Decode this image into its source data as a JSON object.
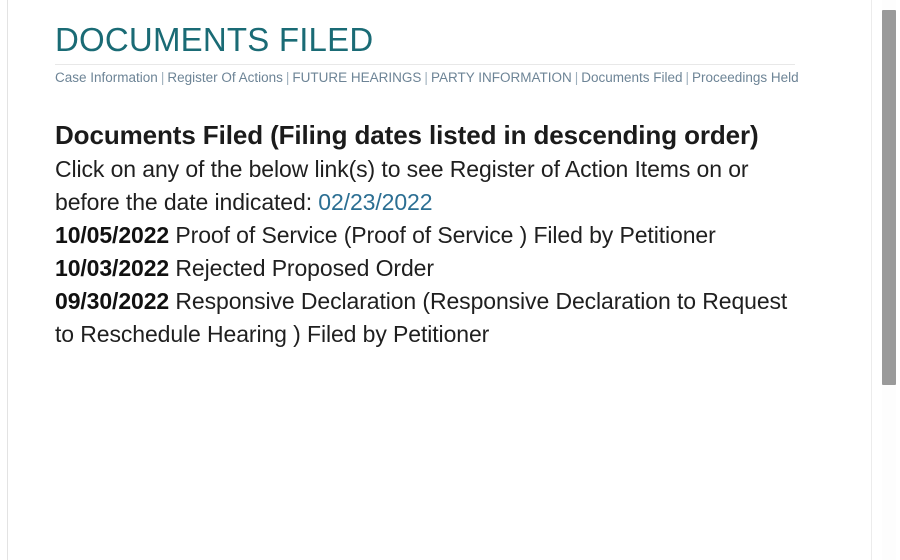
{
  "page": {
    "title": "DOCUMENTS FILED",
    "accent_color": "#1a6b75",
    "link_color": "#2c6f93",
    "nav_color": "#6d8496",
    "background": "#ffffff"
  },
  "nav": {
    "separator": "|",
    "items": [
      {
        "label": "Case Information"
      },
      {
        "label": "Register Of Actions"
      },
      {
        "label": "FUTURE HEARINGS"
      },
      {
        "label": "PARTY INFORMATION"
      },
      {
        "label": "Documents Filed"
      },
      {
        "label": "Proceedings Held"
      }
    ]
  },
  "main": {
    "section_heading": "Documents Filed (Filing dates listed in descending order)",
    "instructions_text": "Click on any of the below link(s) to see Register of Action Items on or before the date indicated:",
    "instructions_date_link": "02/23/2022",
    "entries": [
      {
        "date": "10/05/2022",
        "description": "Proof of Service (Proof of Service )  Filed by Petitioner"
      },
      {
        "date": "10/03/2022",
        "description": "Rejected Proposed Order"
      },
      {
        "date": "09/30/2022",
        "description": "Responsive Declaration (Responsive Declaration to Request to Reschedule Hearing )  Filed by Petitioner"
      }
    ]
  },
  "scrollbar": {
    "orientation": "vertical",
    "thumb_color": "#9a9a9a"
  }
}
